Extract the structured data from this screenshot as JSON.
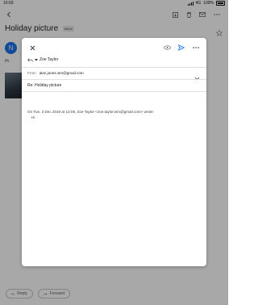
{
  "status_bar": {
    "time": "10:03",
    "network": "4G",
    "battery": "100%"
  },
  "toolbar": {
    "back_icon": "back-arrow-icon",
    "archive_icon": "archive-icon",
    "delete_icon": "trash-icon",
    "mail_icon": "mail-icon",
    "more_icon": "more-icon"
  },
  "email": {
    "subject": "Holiday picture",
    "label": "Inbox",
    "sender_initial": "N",
    "body_preview": "Hi"
  },
  "actions": {
    "reply": "Reply",
    "forward": "Forward"
  },
  "compose": {
    "reply_to": "Zoe Taylor",
    "from_label": "From",
    "from_address": "alan.jones.wm@gmail.com",
    "subject": "Re: Holiday picture",
    "quote_header": "On Tue, 3 Dec 2019 at 13:09, Zoe Taylor <zoe.taylor.wm@gmail.com> wrote:",
    "quote_body": "Hi"
  },
  "colors": {
    "accent": "#1a73e8",
    "scrim": "rgba(0,0,0,0.34)"
  }
}
